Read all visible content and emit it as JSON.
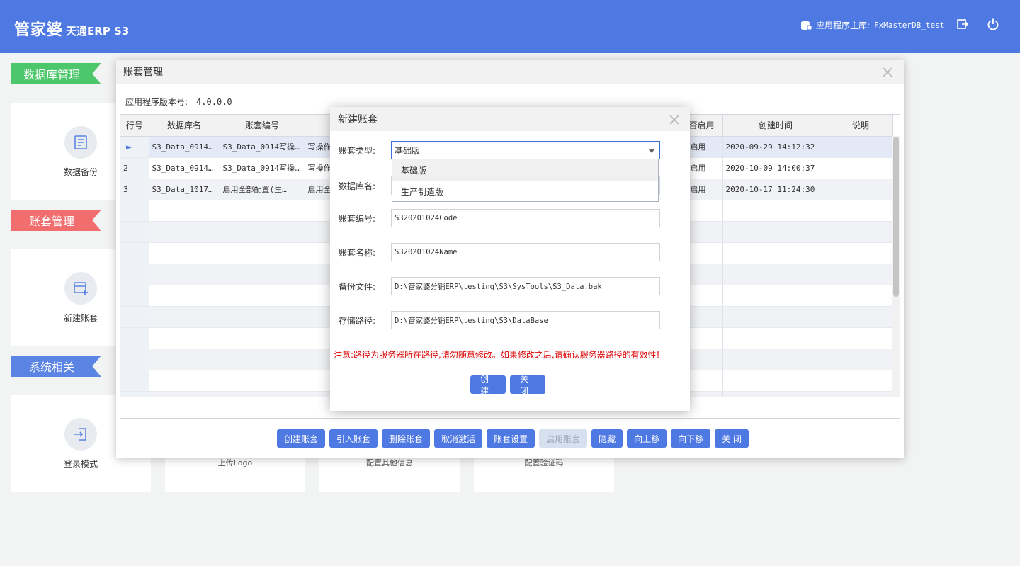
{
  "header": {
    "logo_main": "管家婆",
    "logo_sub": "天通ERP S3",
    "db_label": "应用程序主库:",
    "db_name": "FxMasterDB_test"
  },
  "sidebar": {
    "sections": [
      {
        "label": "数据库管理",
        "color": "#4ec76c"
      },
      {
        "label": "账套管理",
        "color": "#f26d6d"
      },
      {
        "label": "系统相关",
        "color": "#5b84e4"
      }
    ],
    "cards": {
      "backup": "数据备份",
      "new_account": "新建账套",
      "login_mode": "登录模式",
      "upload_logo": "上传Logo",
      "other_info": "配置其他信息",
      "captcha": "配置验证码"
    }
  },
  "main_dialog": {
    "title": "账套管理",
    "version_label": "应用程序版本号:",
    "version": "4.0.0.0",
    "columns": [
      "行号",
      "数据库名",
      "账套编号",
      "",
      "否启用",
      "创建时间",
      "说明"
    ],
    "rows": [
      {
        "no": "2",
        "db": "S3_Data_0914…",
        "code": "S3_Data_0914写操…",
        "name": "写操作",
        "enabled": "启用",
        "created": "2020-10-09 14:00:37",
        "note": ""
      },
      {
        "no": "3",
        "db": "S3_Data_1017…",
        "code": "启用全部配置(生…",
        "name": "启用全",
        "enabled": "启用",
        "created": "2020-10-17 11:24:30",
        "note": ""
      }
    ],
    "selected_row": {
      "marker": "►",
      "db": "S3_Data_0914…",
      "code": "S3_Data_0914写操…",
      "name": "写操作",
      "enabled": "启用",
      "created": "2020-09-29 14:12:32",
      "note": ""
    },
    "buttons": [
      "创建账套",
      "引入账套",
      "删除账套",
      "取消激活",
      "账套设置",
      "启用账套",
      "隐藏",
      "向上移",
      "向下移",
      "关 闭"
    ]
  },
  "modal": {
    "title": "新建账套",
    "fields": {
      "type_label": "账套类型:",
      "type_value": "基础版",
      "dbname_label": "数据库名:",
      "code_label": "账套编号:",
      "code_value": "S320201024Code",
      "name_label": "账套名称:",
      "name_value": "S320201024Name",
      "backup_label": "备份文件:",
      "backup_value": "D:\\管家婆分销ERP\\testing\\S3\\SysTools\\S3_Data.bak",
      "path_label": "存储路径:",
      "path_value": "D:\\管家婆分销ERP\\testing\\S3\\DataBase"
    },
    "dropdown_options": [
      "基础版",
      "生产制造版"
    ],
    "warning": "注意:路径为服务器所在路径,请勿随意修改。如果修改之后,请确认服务器路径的有效性!",
    "create_button": "创建",
    "close_button": "关闭"
  }
}
